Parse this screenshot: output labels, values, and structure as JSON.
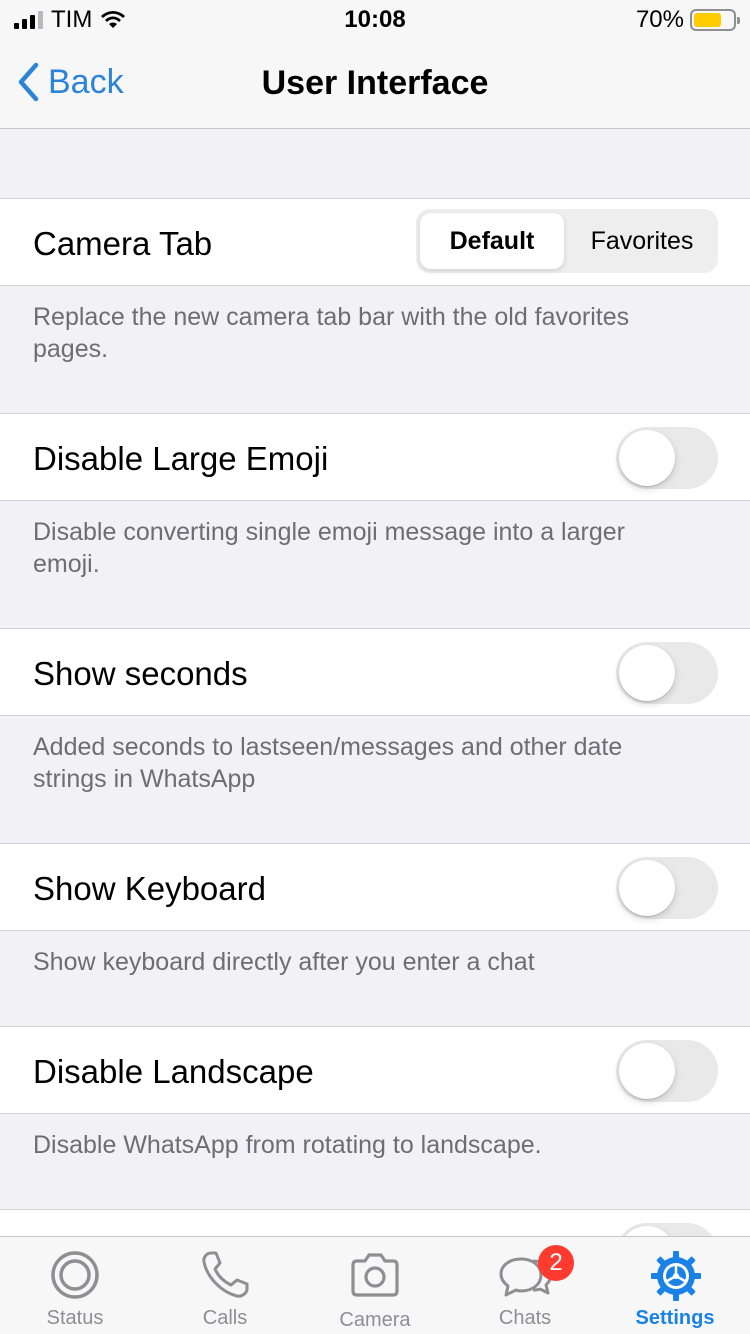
{
  "status_bar": {
    "carrier": "TIM",
    "time": "10:08",
    "battery_percent": "70%",
    "battery_level": 0.7,
    "battery_color": "#ffcc00"
  },
  "nav": {
    "back_label": "Back",
    "title": "User Interface",
    "accent_color": "#2c84d8"
  },
  "settings": {
    "camera_tab": {
      "label": "Camera Tab",
      "options": [
        "Default",
        "Favorites"
      ],
      "selected": "Default",
      "description": "Replace the new camera tab bar with the old favorites pages."
    },
    "disable_large_emoji": {
      "label": "Disable Large Emoji",
      "enabled": false,
      "description": "Disable converting single emoji message into a larger emoji."
    },
    "show_seconds": {
      "label": "Show seconds",
      "enabled": false,
      "description": "Added seconds to lastseen/messages and other date strings in WhatsApp"
    },
    "show_keyboard": {
      "label": "Show Keyboard",
      "enabled": false,
      "description": "Show keyboard directly after you enter a chat"
    },
    "disable_landscape": {
      "label": "Disable Landscape",
      "enabled": false,
      "description": "Disable WhatsApp from rotating to landscape."
    },
    "partial_row": {
      "enabled": false
    }
  },
  "tab_bar": {
    "tabs": [
      {
        "label": "Status",
        "icon": "status-icon",
        "active": false
      },
      {
        "label": "Calls",
        "icon": "phone-icon",
        "active": false
      },
      {
        "label": "Camera",
        "icon": "camera-icon",
        "active": false
      },
      {
        "label": "Chats",
        "icon": "chats-icon",
        "active": false,
        "badge": "2"
      },
      {
        "label": "Settings",
        "icon": "gear-icon",
        "active": true
      }
    ],
    "active_color": "#1a82e6",
    "badge_color": "#ff3b30"
  }
}
